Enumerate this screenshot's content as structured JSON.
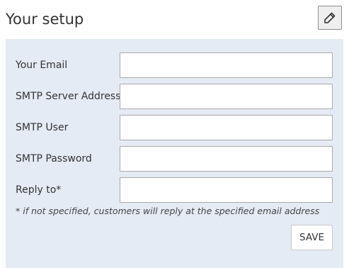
{
  "header": {
    "title": "Your setup",
    "edit_icon": "pencil-icon"
  },
  "form": {
    "fields": [
      {
        "label": "Your Email",
        "value": "",
        "placeholder": ""
      },
      {
        "label": "SMTP Server Address",
        "value": "",
        "placeholder": ""
      },
      {
        "label": "SMTP User",
        "value": "",
        "placeholder": ""
      },
      {
        "label": "SMTP Password",
        "value": "",
        "placeholder": ""
      },
      {
        "label": "Reply to*",
        "value": "",
        "placeholder": ""
      }
    ],
    "note": "* if not specified, customers will reply at the specified email address",
    "save_label": "SAVE"
  },
  "colors": {
    "panel_background": "#e5ebf4",
    "text": "#333333",
    "input_border": "#a9a9a9"
  }
}
